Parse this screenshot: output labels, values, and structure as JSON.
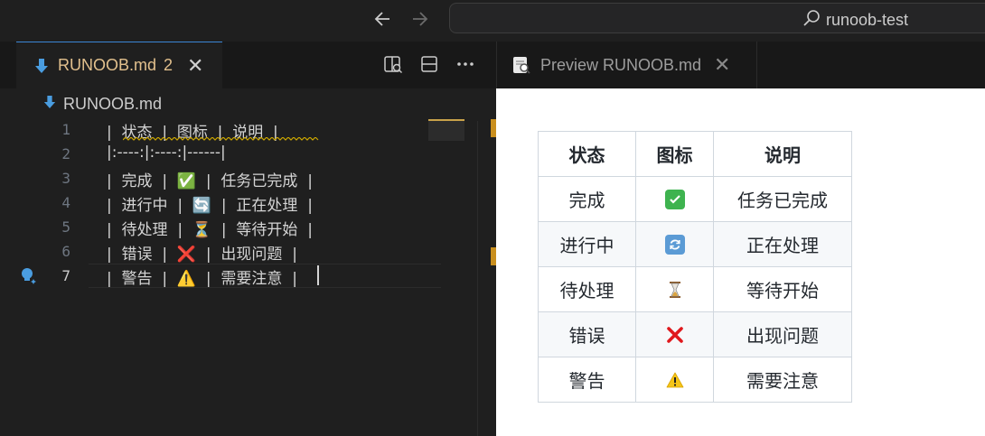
{
  "titlebar": {
    "search_text": "runoob-test"
  },
  "editor": {
    "tab": {
      "title": "RUNOOB.md",
      "badge": "2",
      "close": "✕"
    },
    "breadcrumb": "RUNOOB.md",
    "lines": [
      {
        "num": "1",
        "text": "|  状态  |  图标  |  说明  |"
      },
      {
        "num": "2",
        "text": "|:----:|:----:|------|"
      },
      {
        "num": "3",
        "text": "|  完成  |  ✅  |  任务已完成  |"
      },
      {
        "num": "4",
        "text": "|  进行中  |  🔄  |  正在处理  |"
      },
      {
        "num": "5",
        "text": "|  待处理  |  ⏳  |  等待开始  |"
      },
      {
        "num": "6",
        "text": "|  错误  |  ❌  |  出现问题  |"
      },
      {
        "num": "7",
        "text": "|  警告  |  ⚠️  |  需要注意  |"
      }
    ]
  },
  "preview": {
    "tab": {
      "title": "Preview RUNOOB.md",
      "close": "✕"
    },
    "table": {
      "headers": [
        "状态",
        "图标",
        "说明"
      ],
      "rows": [
        {
          "status": "完成",
          "icon": "✅",
          "icon_name": "check-mark-icon",
          "desc": "任务已完成"
        },
        {
          "status": "进行中",
          "icon": "🔄",
          "icon_name": "refresh-icon",
          "desc": "正在处理"
        },
        {
          "status": "待处理",
          "icon": "⏳",
          "icon_name": "hourglass-icon",
          "desc": "等待开始"
        },
        {
          "status": "错误",
          "icon": "❌",
          "icon_name": "cross-mark-icon",
          "desc": "出现问题"
        },
        {
          "status": "警告",
          "icon": "⚠️",
          "icon_name": "warning-icon",
          "desc": "需要注意"
        }
      ]
    }
  },
  "colors": {
    "modified_tab": "#e2c08d",
    "accent": "#3a86d6",
    "squiggle": "#cca700",
    "scroll_marker": "#c98f1e"
  }
}
